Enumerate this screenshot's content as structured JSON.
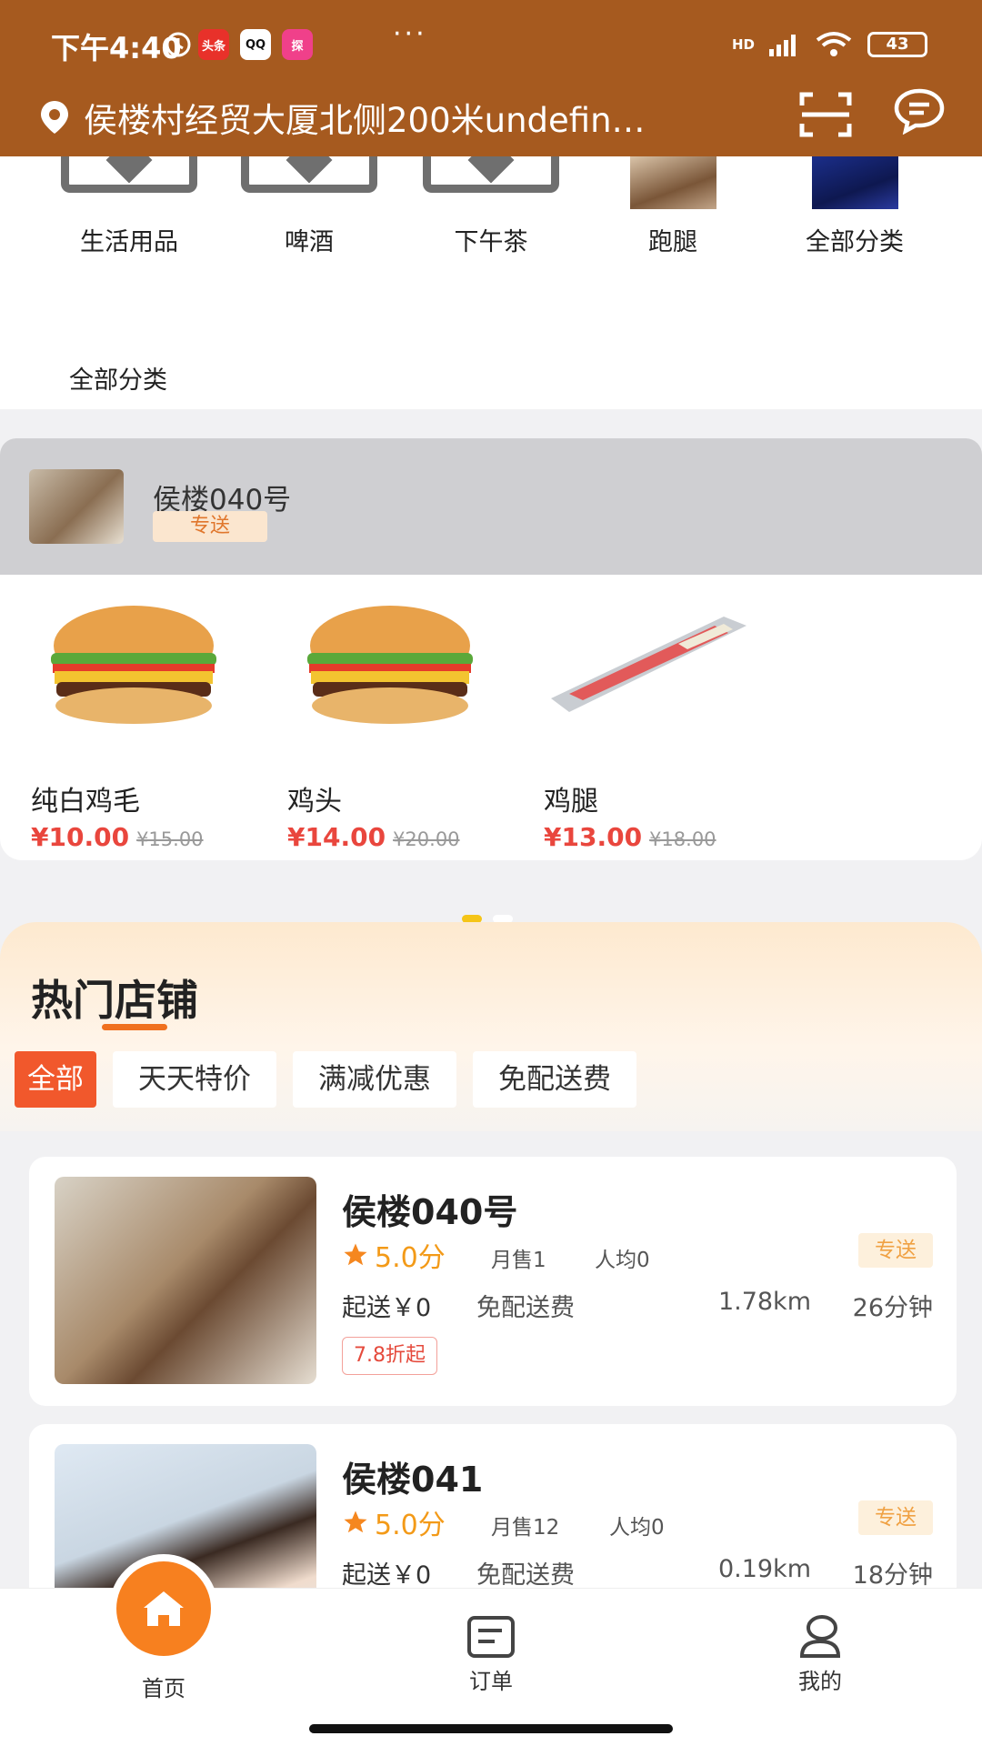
{
  "status_bar": {
    "time": "下午4:40",
    "app_icons": [
      "头条",
      "QQ",
      "探"
    ],
    "more": "···",
    "network": "HD",
    "battery": "43"
  },
  "header": {
    "location": "侯楼村经贸大厦北侧200米undefin…",
    "location_icon": "map-pin-icon",
    "scan_icon": "scan-icon",
    "message_icon": "message-icon",
    "bg_color": "#a65a1f"
  },
  "categories": {
    "items": [
      {
        "label": "生活用品"
      },
      {
        "label": "啤酒"
      },
      {
        "label": "下午茶"
      },
      {
        "label": "跑腿"
      },
      {
        "label": "全部分类"
      }
    ],
    "row2_label": "全部分类"
  },
  "featured_shop": {
    "name": "侯楼040号",
    "badge": "专送",
    "products": [
      {
        "name": "纯白鸡毛",
        "price": "¥10.00",
        "old_price": "¥15.00"
      },
      {
        "name": "鸡头",
        "price": "¥14.00",
        "old_price": "¥20.00"
      },
      {
        "name": "鸡腿",
        "price": "¥13.00",
        "old_price": "¥18.00"
      }
    ]
  },
  "hot_shops": {
    "title": "热门店铺",
    "filters": [
      "全部",
      "天天特价",
      "满减优惠",
      "免配送费"
    ],
    "shops": [
      {
        "name": "侯楼040号",
        "score": "5.0分",
        "monthly_sales": "月售1",
        "avg_spend": "人均0",
        "tag": "专送",
        "min_order": "起送￥0",
        "delivery_fee": "免配送费",
        "distance": "1.78km",
        "eta": "26分钟",
        "discount": "7.8折起"
      },
      {
        "name": "侯楼041",
        "score": "5.0分",
        "monthly_sales": "月售12",
        "avg_spend": "人均0",
        "tag": "专送",
        "min_order": "起送￥0",
        "delivery_fee": "免配送费",
        "distance": "0.19km",
        "eta": "18分钟"
      }
    ]
  },
  "tabbar": {
    "home": "首页",
    "orders": "订单",
    "mine": "我的",
    "accent": "#f7801f"
  }
}
